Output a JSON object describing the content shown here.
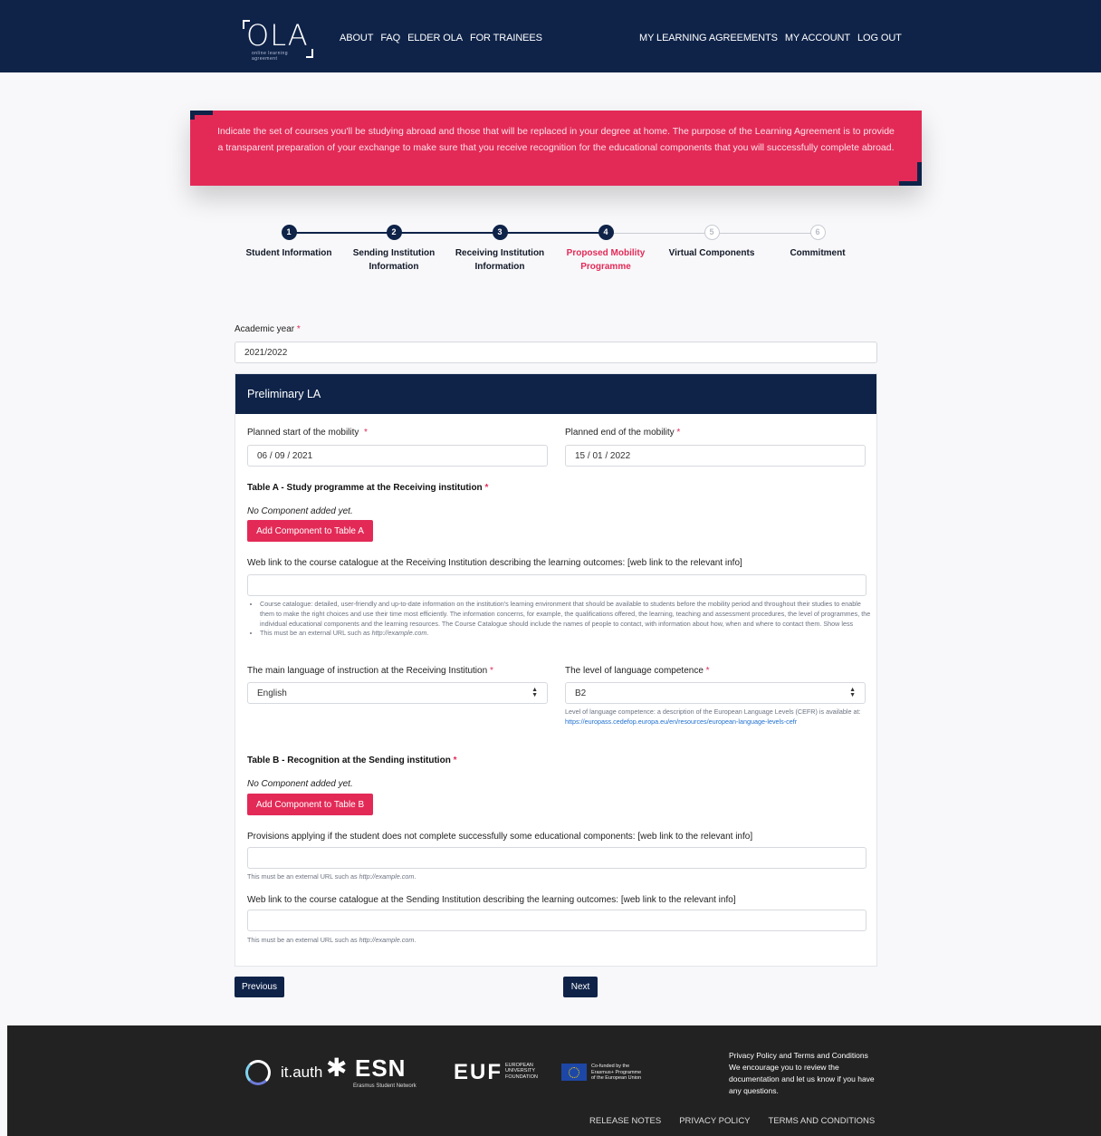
{
  "header": {
    "logo_text": "OLA",
    "logo_sub": "online learning agreement",
    "nav_left": [
      "ABOUT",
      "FAQ",
      "ELDER OLA",
      "FOR TRAINEES"
    ],
    "nav_right": [
      "MY LEARNING AGREEMENTS",
      "MY ACCOUNT",
      "LOG OUT"
    ]
  },
  "banner": {
    "text": "Indicate the set of courses you'll be studying abroad and those that will be replaced in your degree at home. The purpose of the Learning Agreement is to provide a transparent preparation of your exchange to make sure that you receive recognition for the educational components that you will successfully complete abroad."
  },
  "stepper": {
    "steps": [
      {
        "num": "1",
        "label": "Student Information",
        "state": "done"
      },
      {
        "num": "2",
        "label": "Sending Institution Information",
        "state": "done"
      },
      {
        "num": "3",
        "label": "Receiving Institution Information",
        "state": "done"
      },
      {
        "num": "4",
        "label": "Proposed Mobility Programme",
        "state": "active"
      },
      {
        "num": "5",
        "label": "Virtual Components",
        "state": "todo"
      },
      {
        "num": "6",
        "label": "Commitment",
        "state": "todo"
      }
    ]
  },
  "form": {
    "academic_year_label": "Academic year",
    "academic_year_value": "2021/2022",
    "required_mark": "*",
    "card_title": "Preliminary LA",
    "planned_start_label": "Planned start of the mobility",
    "planned_start_value": "06 / 09 / 2021",
    "planned_end_label": "Planned end of the mobility",
    "planned_end_value": "15 / 01 / 2022",
    "table_a_title": "Table A - Study programme at the Receiving institution",
    "table_a_empty": "No Component added yet.",
    "table_a_button": "Add Component to Table A",
    "receiving_catalogue_label": "Web link to the course catalogue at the Receiving Institution describing the learning outcomes: [web link to the relevant info]",
    "catalogue_help_1": "Course catalogue: detailed, user-friendly and up-to-date information on the institution's learning environment that should be available to students before the mobility period and throughout their studies to enable them to make the right choices and use their time most efficiently. The information concerns, for example, the qualifications offered, the learning, teaching and assessment procedures, the level of programmes, the individual educational components and the learning resources. The Course Catalogue should include the names of people to contact, with information about how, when and where to contact them. Show less",
    "url_help_prefix": "This must be an external URL such as",
    "url_example": "http://example.com",
    "url_help_suffix": ".",
    "language_label": "The main language of instruction at the Receiving Institution",
    "language_value": "English",
    "competence_label": "The level of language competence",
    "competence_value": "B2",
    "competence_help": "Level of language competence: a description of the European Language Levels (CEFR) is available at:",
    "competence_link": "https://europass.cedefop.europa.eu/en/resources/european-language-levels-cefr",
    "table_b_title": "Table B - Recognition at the Sending institution",
    "table_b_empty": "No Component added yet.",
    "table_b_button": "Add Component to Table B",
    "provisions_label": "Provisions applying if the student does not complete successfully some educational components: [web link to the relevant info]",
    "sending_catalogue_label": "Web link to the course catalogue at the Sending Institution describing the learning outcomes: [web link to the relevant info]",
    "previous_button": "Previous",
    "next_button": "Next"
  },
  "footer": {
    "ithauth": "it.auth",
    "esn": "ESN",
    "esn_sub": "Erasmus Student Network",
    "euf": "EUF",
    "euf_sub_1": "EUROPEAN",
    "euf_sub_2": "UNIVERSITY",
    "euf_sub_3": "FOUNDATION",
    "eu_sub_1": "Co-funded by the",
    "eu_sub_2": "Erasmus+ Programme",
    "eu_sub_3": "of the European Union",
    "privacy_title": "Privacy Policy and Terms and Conditions",
    "privacy_text": "We encourage you to review the documentation and let us know if you have any questions.",
    "links": [
      "RELEASE NOTES",
      "PRIVACY POLICY",
      "TERMS AND CONDITIONS"
    ]
  },
  "colors": {
    "navy": "#0f2349",
    "accent": "#e32a57",
    "footer": "#222222"
  }
}
